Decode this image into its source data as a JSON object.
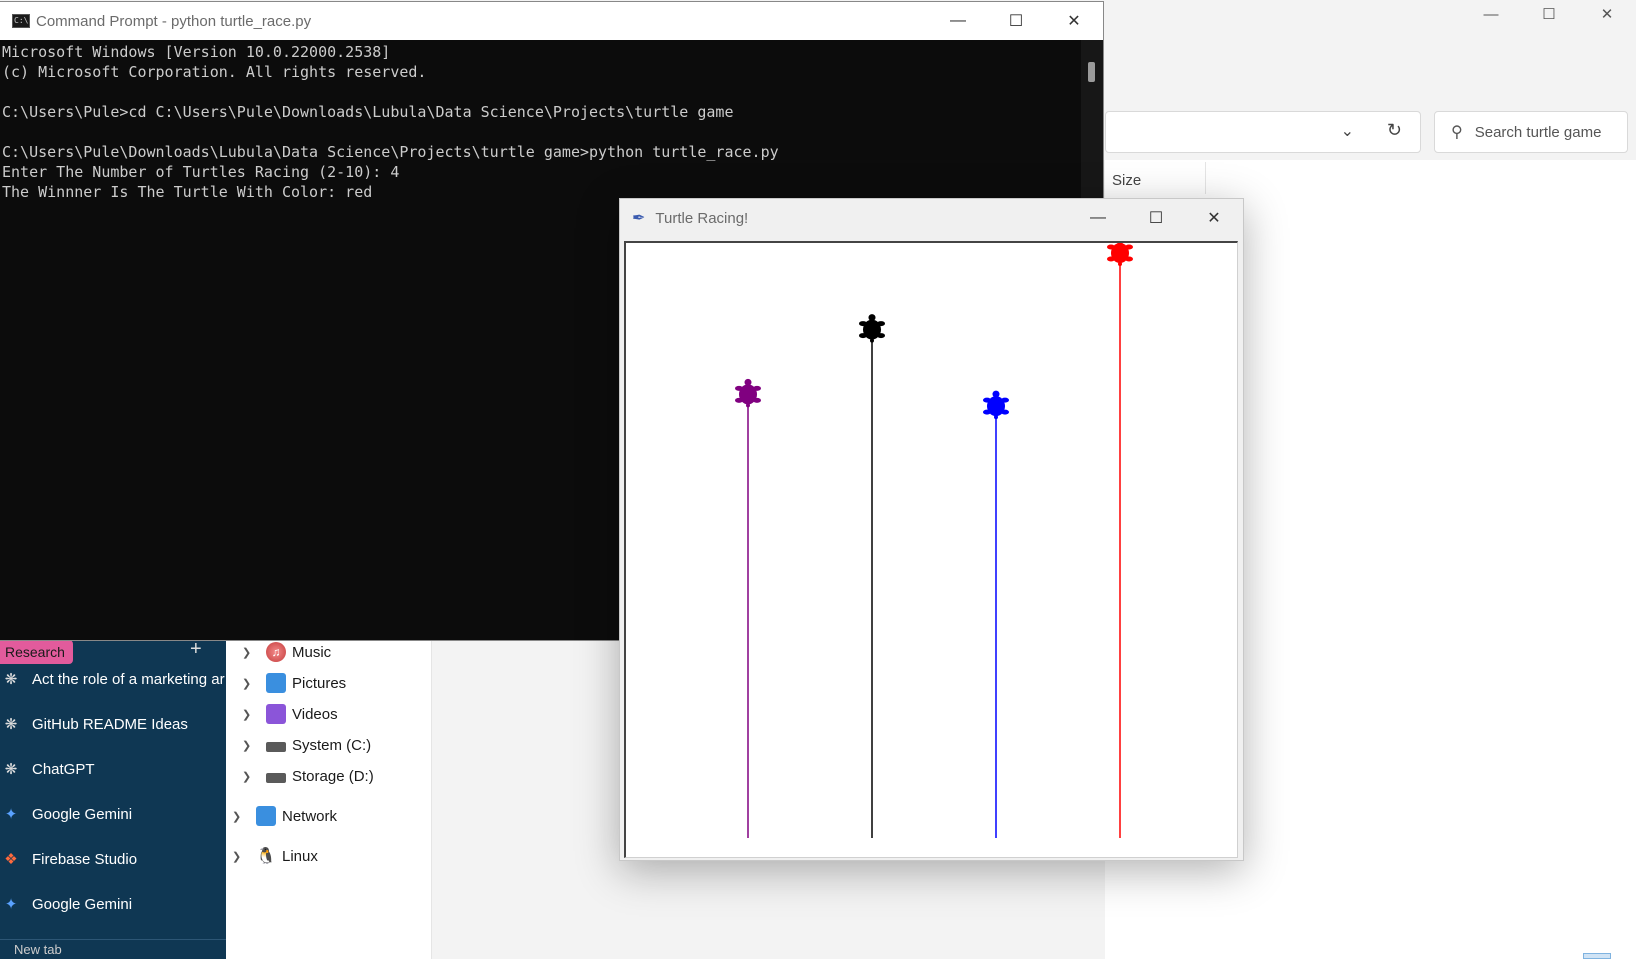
{
  "cmd": {
    "title": "Command Prompt - python  turtle_race.py",
    "lines": [
      "Microsoft Windows [Version 10.0.22000.2538]",
      "(c) Microsoft Corporation. All rights reserved.",
      "",
      "C:\\Users\\Pule>cd C:\\Users\\Pule\\Downloads\\Lubula\\Data Science\\Projects\\turtle game",
      "",
      "C:\\Users\\Pule\\Downloads\\Lubula\\Data Science\\Projects\\turtle game>python turtle_race.py",
      "Enter The Number of Turtles Racing (2-10): 4",
      "The Winnner Is The Turtle With Color: red"
    ]
  },
  "turtle_window": {
    "title": "Turtle Racing!",
    "turtles": [
      {
        "color": "purple",
        "hex": "#800080",
        "progress": 0.76
      },
      {
        "color": "black",
        "hex": "#000000",
        "progress": 0.87
      },
      {
        "color": "blue",
        "hex": "#0000ff",
        "progress": 0.74
      },
      {
        "color": "red",
        "hex": "#ff0000",
        "progress": 1.0
      }
    ]
  },
  "explorer": {
    "search_placeholder": "Search turtle game",
    "column_size": "Size",
    "nav_items": [
      {
        "label": "Music",
        "icon": "music-icon"
      },
      {
        "label": "Pictures",
        "icon": "pictures-icon"
      },
      {
        "label": "Videos",
        "icon": "videos-icon"
      },
      {
        "label": "System (C:)",
        "icon": "drive-icon"
      },
      {
        "label": "Storage (D:)",
        "icon": "drive-icon"
      },
      {
        "label": "Network",
        "icon": "network-icon"
      },
      {
        "label": "Linux",
        "icon": "linux-icon"
      }
    ]
  },
  "sidebar": {
    "research_label": "Research",
    "items": [
      {
        "label": "Act the role of a marketing ar",
        "icon": "chatgpt-icon"
      },
      {
        "label": "GitHub README Ideas",
        "icon": "chatgpt-icon"
      },
      {
        "label": "ChatGPT",
        "icon": "chatgpt-icon"
      },
      {
        "label": "Google Gemini",
        "icon": "gemini-icon"
      },
      {
        "label": "Firebase Studio",
        "icon": "firebase-icon"
      },
      {
        "label": "Google Gemini",
        "icon": "gemini-icon"
      }
    ],
    "new_tab": "New tab"
  }
}
